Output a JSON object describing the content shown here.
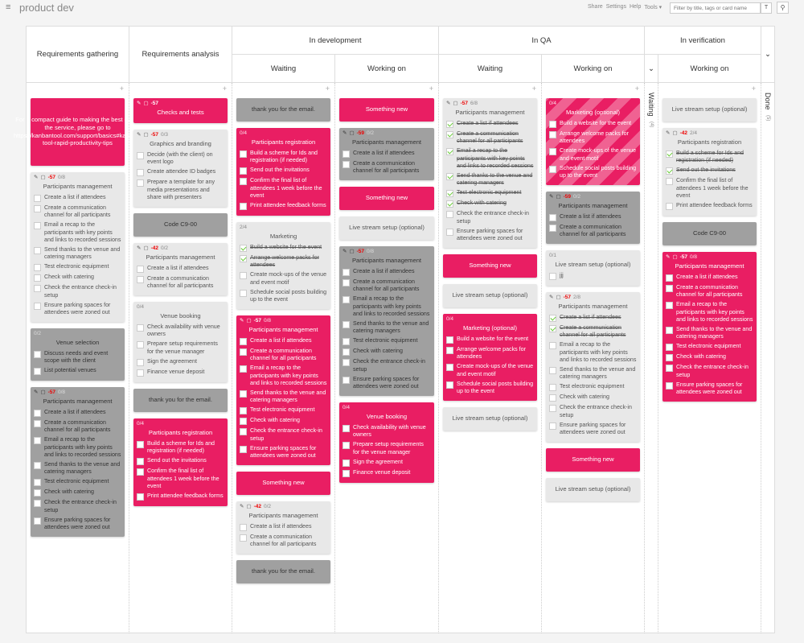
{
  "app": {
    "board_title": "product dev",
    "menu_icon": "hamburger-icon",
    "links": [
      "Share",
      "Settings",
      "Help",
      "Tools ▾"
    ],
    "filter_placeholder": "Filter by title, tags or card name",
    "filter_btn": "T",
    "search_icon": "⚲"
  },
  "headers": {
    "req_gathering": "Requirements gathering",
    "req_analysis": "Requirements analysis",
    "in_dev": "In development",
    "in_qa": "In QA",
    "in_verif": "In verification",
    "waiting": "Waiting",
    "working_on": "Working on",
    "verif_waiting": "Waiting",
    "verif_waiting_count": "(4)",
    "done": "Done",
    "done_count": "(5)"
  },
  "colors": {
    "accent": "#e91e63",
    "gray_card": "#a0a0a0",
    "light_card": "#e8e8e8"
  },
  "columns": [
    {
      "id": "req-gathering",
      "cards": [
        {
          "style": "pink",
          "simple": true,
          "text": "For a compact guide to making the best out of the service, please go to https://kanbantool.com/support/basics#kanban-tool-rapid-productivity-tips",
          "h": 84
        },
        {
          "style": "light",
          "due": "-57",
          "count": "0/8",
          "title": "Participants management",
          "tasks": [
            {
              "t": "Create a list if attendees",
              "d": false
            },
            {
              "t": "Create a communication channel for all participants",
              "d": false
            },
            {
              "t": "Email a recap to the participants with key points and links to recorded sessions",
              "d": false
            },
            {
              "t": "Send thanks to the venue and catering managers",
              "d": false
            },
            {
              "t": "Test electronic equipment",
              "d": false
            },
            {
              "t": "Check with catering",
              "d": false
            },
            {
              "t": "Check the entrance check-in setup",
              "d": false
            },
            {
              "t": "Ensure parking spaces for attendees were zoned out",
              "d": false
            }
          ]
        },
        {
          "style": "gray",
          "count": "0/2",
          "title": "Venue selection",
          "tasks": [
            {
              "t": "Discuss needs and event scope with the client",
              "d": false
            },
            {
              "t": "List potential venues",
              "d": false
            }
          ]
        },
        {
          "style": "gray",
          "due": "-57",
          "count": "0/8",
          "title": "Participants management",
          "tasks": [
            {
              "t": "Create a list if attendees",
              "d": false
            },
            {
              "t": "Create a communication channel for all participants",
              "d": false
            },
            {
              "t": "Email a recap to the participants with key points and links to recorded sessions",
              "d": false
            },
            {
              "t": "Send thanks to the venue and catering managers",
              "d": false
            },
            {
              "t": "Test electronic equipment",
              "d": false
            },
            {
              "t": "Check with catering",
              "d": false
            },
            {
              "t": "Check the entrance check-in setup",
              "d": false
            },
            {
              "t": "Ensure parking spaces for attendees were zoned out",
              "d": false
            }
          ]
        }
      ]
    },
    {
      "id": "req-analysis",
      "cards": [
        {
          "style": "pink",
          "due": "-57",
          "title": "Checks and tests",
          "tasks": []
        },
        {
          "style": "light",
          "due": "-57",
          "count": "0/3",
          "title": "Graphics and branding",
          "tasks": [
            {
              "t": "Decide (with the client) on event logo",
              "d": false
            },
            {
              "t": "Create attendee ID badges",
              "d": false
            },
            {
              "t": "Prepare a template for any media presentations and share with presenters",
              "d": false
            }
          ]
        },
        {
          "style": "gray",
          "simple": true,
          "text": "Code C9-00",
          "h": 29
        },
        {
          "style": "light",
          "due": "-42",
          "count": "0/2",
          "title": "Participants management",
          "tasks": [
            {
              "t": "Create a list if attendees",
              "d": false
            },
            {
              "t": "Create a communication channel for all participants",
              "d": false
            }
          ]
        },
        {
          "style": "light",
          "count": "0/4",
          "title": "Venue booking",
          "tasks": [
            {
              "t": "Check availability with venue owners",
              "d": false
            },
            {
              "t": "Prepare setup requirements for the venue manager",
              "d": false
            },
            {
              "t": "Sign the agreement",
              "d": false
            },
            {
              "t": "Finance venue deposit",
              "d": false
            }
          ]
        },
        {
          "style": "gray",
          "simple": true,
          "text": "thank you for the email.",
          "h": 29
        },
        {
          "style": "pink",
          "count": "0/4",
          "title": "Participants registration",
          "tasks": [
            {
              "t": "Build a scheme for Ids and registration (if needed)",
              "d": false
            },
            {
              "t": "Send out the invitations",
              "d": false
            },
            {
              "t": "Confirm the final list of attendees 1 week before the event",
              "d": false
            },
            {
              "t": "Print attendee feedback forms",
              "d": false
            }
          ]
        }
      ]
    },
    {
      "id": "dev-waiting",
      "cards": [
        {
          "style": "gray",
          "simple": true,
          "text": "thank you for the email.",
          "h": 29
        },
        {
          "style": "pink",
          "count": "0/4",
          "title": "Participants registration",
          "tasks": [
            {
              "t": "Build a scheme for Ids and registration (if needed)",
              "d": false
            },
            {
              "t": "Send out the invitations",
              "d": false
            },
            {
              "t": "Confirm the final list of attendees 1 week before the event",
              "d": false
            },
            {
              "t": "Print attendee feedback forms",
              "d": false
            }
          ]
        },
        {
          "style": "light",
          "count": "2/4",
          "title": "Marketing",
          "tasks": [
            {
              "t": "Build a website for the event",
              "d": true
            },
            {
              "t": "Arrange welcome packs for attendees",
              "d": true
            },
            {
              "t": "Create mock-ups of the venue and event motif",
              "d": false
            },
            {
              "t": "Schedule social posts building up to the event",
              "d": false
            }
          ]
        },
        {
          "style": "pink",
          "due": "-57",
          "count": "0/8",
          "title": "Participants management",
          "tasks": [
            {
              "t": "Create a list if attendees",
              "d": false
            },
            {
              "t": "Create a communication channel for all participants",
              "d": false
            },
            {
              "t": "Email a recap to the participants with key points and links to recorded sessions",
              "d": false
            },
            {
              "t": "Send thanks to the venue and catering managers",
              "d": false
            },
            {
              "t": "Test electronic equipment",
              "d": false
            },
            {
              "t": "Check with catering",
              "d": false
            },
            {
              "t": "Check the entrance check-in setup",
              "d": false
            },
            {
              "t": "Ensure parking spaces for attendees were zoned out",
              "d": false
            }
          ]
        },
        {
          "style": "pink",
          "simple": true,
          "text": "Something new",
          "h": 29
        },
        {
          "style": "light",
          "due": "-42",
          "count": "0/2",
          "title": "Participants management",
          "tasks": [
            {
              "t": "Create a list if attendees",
              "d": false
            },
            {
              "t": "Create a communication channel for all participants",
              "d": false
            }
          ]
        },
        {
          "style": "gray",
          "simple": true,
          "text": "thank you for the email.",
          "h": 29
        }
      ]
    },
    {
      "id": "dev-working",
      "cards": [
        {
          "style": "pink",
          "simple": true,
          "text": "Something new",
          "h": 29
        },
        {
          "style": "gray",
          "due": "-59",
          "count": "0/2",
          "title": "Participants management",
          "tasks": [
            {
              "t": "Create a list if attendees",
              "d": false
            },
            {
              "t": "Create a communication channel for all participants",
              "d": false
            }
          ]
        },
        {
          "style": "pink",
          "simple": true,
          "text": "Something new",
          "h": 29
        },
        {
          "style": "light",
          "simple": true,
          "text": "Live stream setup (optional)",
          "h": 29
        },
        {
          "style": "gray",
          "due": "-57",
          "count": "0/8",
          "title": "Participants management",
          "tasks": [
            {
              "t": "Create a list if attendees",
              "d": false
            },
            {
              "t": "Create a communication channel for all participants",
              "d": false
            },
            {
              "t": "Email a recap to the participants with key points and links to recorded sessions",
              "d": false
            },
            {
              "t": "Send thanks to the venue and catering managers",
              "d": false
            },
            {
              "t": "Test electronic equipment",
              "d": false
            },
            {
              "t": "Check with catering",
              "d": false
            },
            {
              "t": "Check the entrance check-in setup",
              "d": false
            },
            {
              "t": "Ensure parking spaces for attendees were zoned out",
              "d": false
            }
          ]
        },
        {
          "style": "pink",
          "count": "0/4",
          "title": "Venue booking",
          "tasks": [
            {
              "t": "Check availability with venue owners",
              "d": false
            },
            {
              "t": "Prepare setup requirements for the venue manager",
              "d": false
            },
            {
              "t": "Sign the agreement",
              "d": false
            },
            {
              "t": "Finance venue deposit",
              "d": false
            }
          ]
        }
      ]
    },
    {
      "id": "qa-waiting",
      "cards": [
        {
          "style": "light",
          "due": "-57",
          "count": "6/8",
          "title": "Participants management",
          "tasks": [
            {
              "t": "Create a list if attendees",
              "d": true
            },
            {
              "t": "Create a communication channel for all participants",
              "d": true
            },
            {
              "t": "Email a recap to the participants with key points and links to recorded sessions",
              "d": true
            },
            {
              "t": "Send thanks to the venue and catering managers",
              "d": true
            },
            {
              "t": "Test electronic equipment",
              "d": true
            },
            {
              "t": "Check with catering",
              "d": true
            },
            {
              "t": "Check the entrance check-in setup",
              "d": false
            },
            {
              "t": "Ensure parking spaces for attendees were zoned out",
              "d": false
            }
          ]
        },
        {
          "style": "pink",
          "simple": true,
          "text": "Something new",
          "h": 29
        },
        {
          "style": "light",
          "simple": true,
          "text": "Live stream setup (optional)",
          "h": 29
        },
        {
          "style": "pink",
          "count": "0/4",
          "title": "Marketing (optional)",
          "tasks": [
            {
              "t": "Build a website for the event",
              "d": false
            },
            {
              "t": "Arrange welcome packs for attendees",
              "d": false
            },
            {
              "t": "Create mock-ups of the venue and event motif",
              "d": false
            },
            {
              "t": "Schedule social posts building up to the event",
              "d": false
            }
          ]
        },
        {
          "style": "light",
          "simple": true,
          "text": "Live stream setup (optional)",
          "h": 29
        }
      ]
    },
    {
      "id": "qa-working",
      "cards": [
        {
          "style": "striped",
          "count": "0/4",
          "title": "Marketing (optional)",
          "tasks": [
            {
              "t": "Build a website for the event",
              "d": false
            },
            {
              "t": "Arrange welcome packs for attendees",
              "d": false
            },
            {
              "t": "Create mock-ups of the venue and event motif",
              "d": false
            },
            {
              "t": "Schedule social posts building up to the event",
              "d": false
            }
          ]
        },
        {
          "style": "gray",
          "due": "-59",
          "count": "0/2",
          "title": "Participants management",
          "tasks": [
            {
              "t": "Create a list if attendees",
              "d": false
            },
            {
              "t": "Create a communication channel for all participants",
              "d": false
            }
          ]
        },
        {
          "style": "light",
          "count": "0/1",
          "title": "Live stream setup (optional)",
          "tasks": [
            {
              "t": "jjj",
              "d": false
            }
          ]
        },
        {
          "style": "light",
          "due": "-57",
          "count": "2/8",
          "title": "Participants management",
          "tasks": [
            {
              "t": "Create a list if attendees",
              "d": true
            },
            {
              "t": "Create a communication channel for all participants",
              "d": true
            },
            {
              "t": "Email a recap to the participants with key points and links to recorded sessions",
              "d": false
            },
            {
              "t": "Send thanks to the venue and catering managers",
              "d": false
            },
            {
              "t": "Test electronic equipment",
              "d": false
            },
            {
              "t": "Check with catering",
              "d": false
            },
            {
              "t": "Check the entrance check-in setup",
              "d": false
            },
            {
              "t": "Ensure parking spaces for attendees were zoned out",
              "d": false
            }
          ]
        },
        {
          "style": "pink",
          "simple": true,
          "text": "Something new",
          "h": 29
        },
        {
          "style": "light",
          "simple": true,
          "text": "Live stream setup (optional)",
          "h": 29
        }
      ]
    },
    {
      "id": "verif-working",
      "cards": [
        {
          "style": "light",
          "simple": true,
          "text": "Live stream setup (optional)",
          "h": 29
        },
        {
          "style": "light",
          "due": "-42",
          "count": "2/4",
          "title": "Participants registration",
          "tasks": [
            {
              "t": "Build a scheme for Ids and registration (if needed)",
              "d": true
            },
            {
              "t": "Send out the invitations",
              "d": true
            },
            {
              "t": "Confirm the final list of attendees 1 week before the event",
              "d": false
            },
            {
              "t": "Print attendee feedback forms",
              "d": false
            }
          ]
        },
        {
          "style": "gray",
          "simple": true,
          "text": "Code C9-00",
          "h": 29
        },
        {
          "style": "pink",
          "due": "-57",
          "count": "0/8",
          "title": "Participants management",
          "tasks": [
            {
              "t": "Create a list if attendees",
              "d": false
            },
            {
              "t": "Create a communication channel for all participants",
              "d": false
            },
            {
              "t": "Email a recap to the participants with key points and links to recorded sessions",
              "d": false
            },
            {
              "t": "Send thanks to the venue and catering managers",
              "d": false
            },
            {
              "t": "Test electronic equipment",
              "d": false
            },
            {
              "t": "Check with catering",
              "d": false
            },
            {
              "t": "Check the entrance check-in setup",
              "d": false
            },
            {
              "t": "Ensure parking spaces for attendees were zoned out",
              "d": false
            }
          ]
        }
      ]
    }
  ]
}
